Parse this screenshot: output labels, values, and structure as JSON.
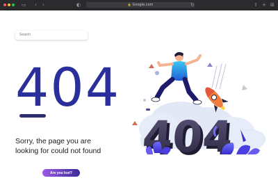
{
  "browser": {
    "address": "Google.com"
  },
  "search": {
    "placeholder": "Search"
  },
  "error": {
    "code": "404",
    "message_line1": "Sorry, the page you are",
    "message_line2": "looking for could not found",
    "illustration_code": "404"
  },
  "actions": {
    "lost_label": "Are you lost?"
  },
  "colors": {
    "heading": "#2b2f9c",
    "button_start": "#9b59e8",
    "button_end": "#3c2a9a"
  }
}
